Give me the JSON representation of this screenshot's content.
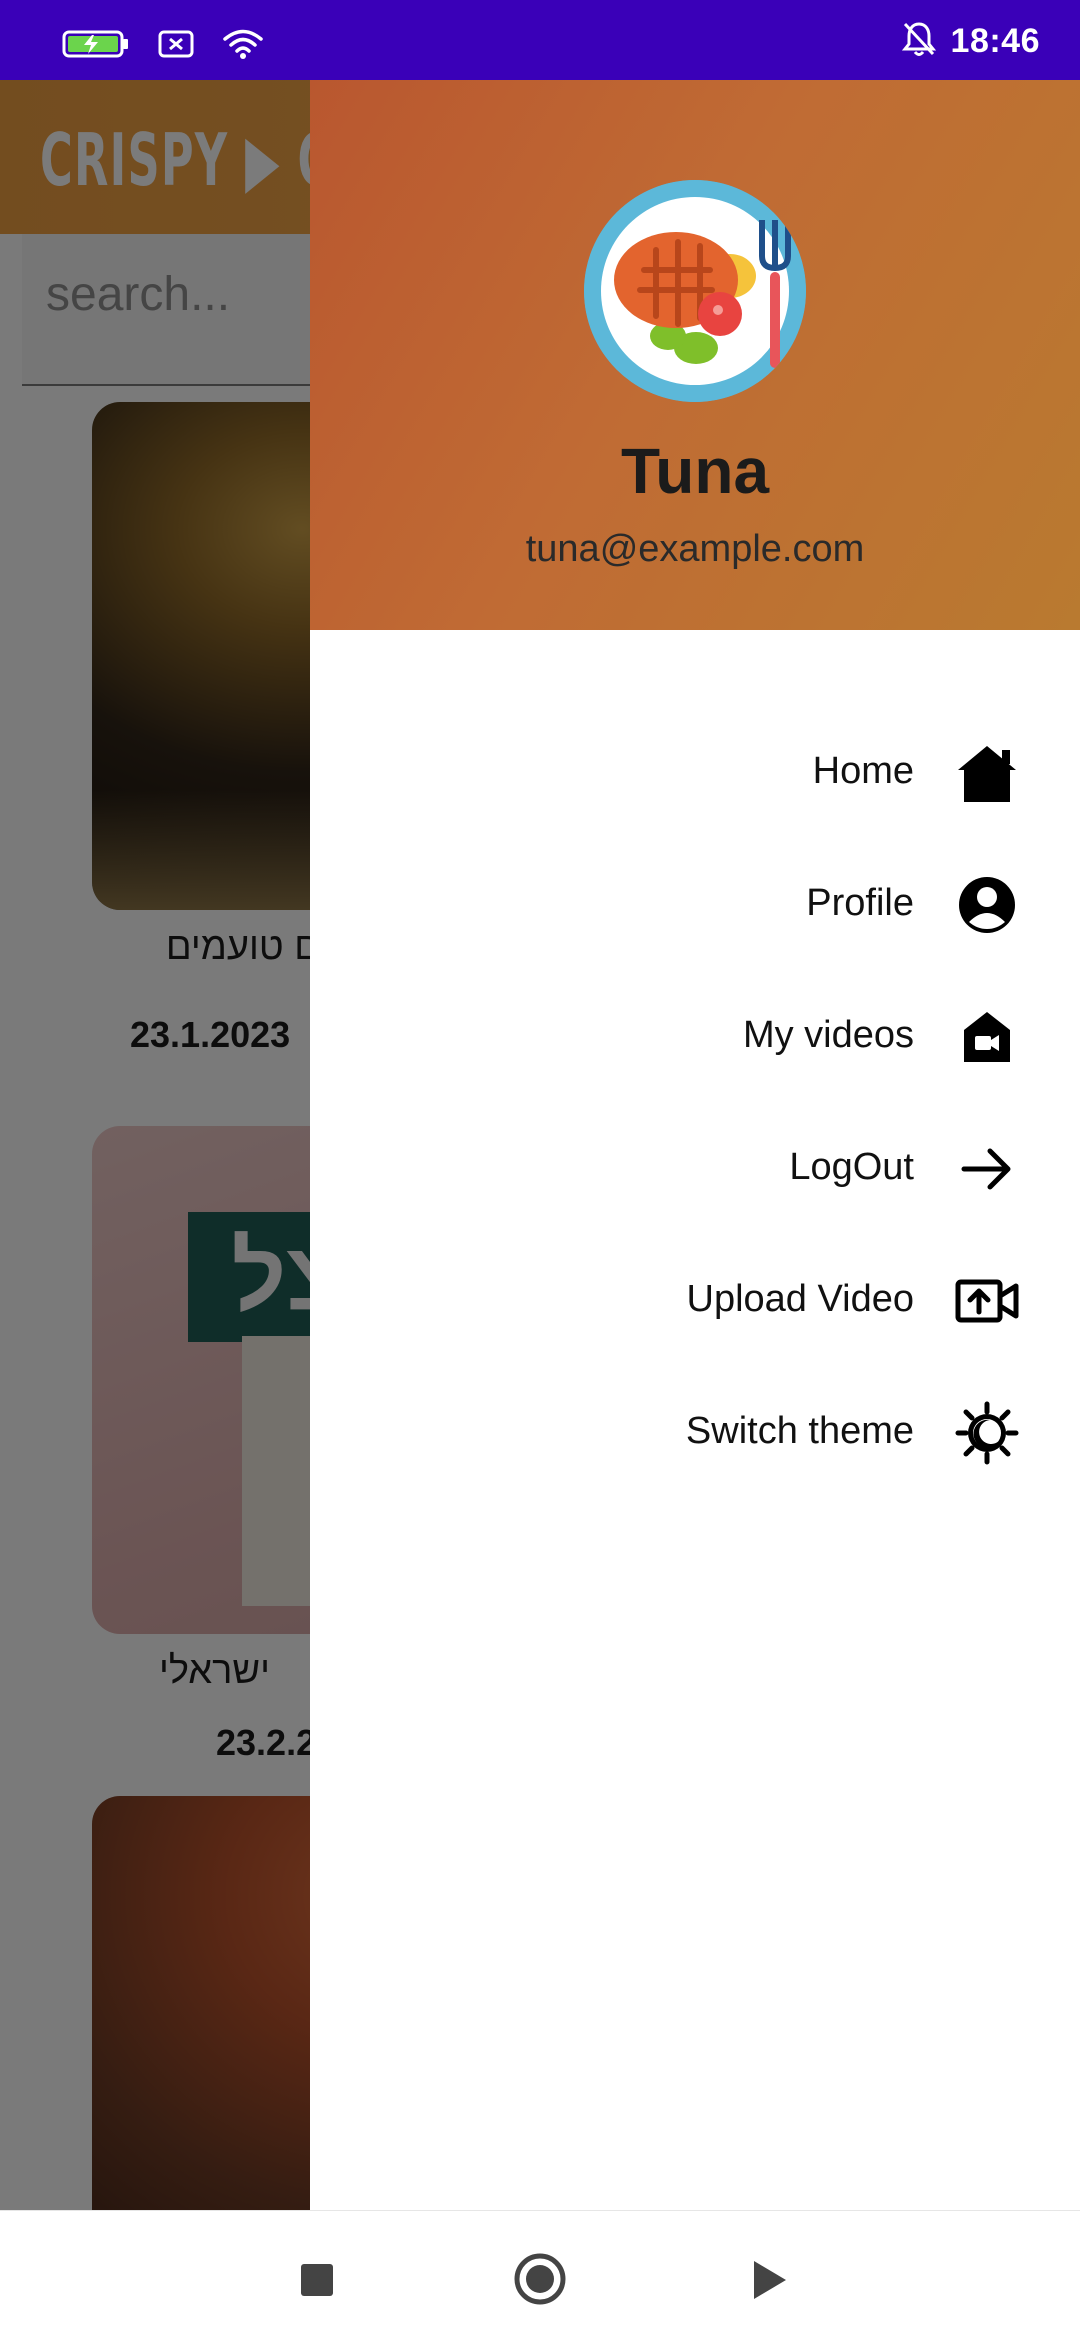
{
  "status_bar": {
    "time": "18:46",
    "icons": [
      "battery-charging-icon",
      "sim-no-signal-icon",
      "wifi-icon",
      "notifications-off-icon"
    ],
    "background_color": "#3a00b8"
  },
  "app": {
    "logo_text": "CRISPY ▶ CRU",
    "search": {
      "placeholder": "search..."
    },
    "videos": [
      {
        "title": "ם טועמים",
        "date": "23.1.2023"
      },
      {
        "title": "ישראלי",
        "date": "23.2.2"
      },
      {
        "title": "",
        "date": ""
      }
    ],
    "card_sign_text": "צל"
  },
  "drawer": {
    "header_color": "#b9572f",
    "user": {
      "name": "Tuna",
      "email": "tuna@example.com"
    },
    "items": [
      {
        "label": "Home",
        "icon": "home-icon"
      },
      {
        "label": "Profile",
        "icon": "account-circle-icon"
      },
      {
        "label": "My videos",
        "icon": "video-home-icon"
      },
      {
        "label": "LogOut",
        "icon": "arrow-right-icon"
      },
      {
        "label": "Upload Video",
        "icon": "video-upload-icon"
      },
      {
        "label": "Switch theme",
        "icon": "theme-toggle-icon"
      }
    ]
  },
  "nav_bar": {
    "buttons": [
      "recents-square-icon",
      "home-circle-icon",
      "back-triangle-icon"
    ]
  }
}
